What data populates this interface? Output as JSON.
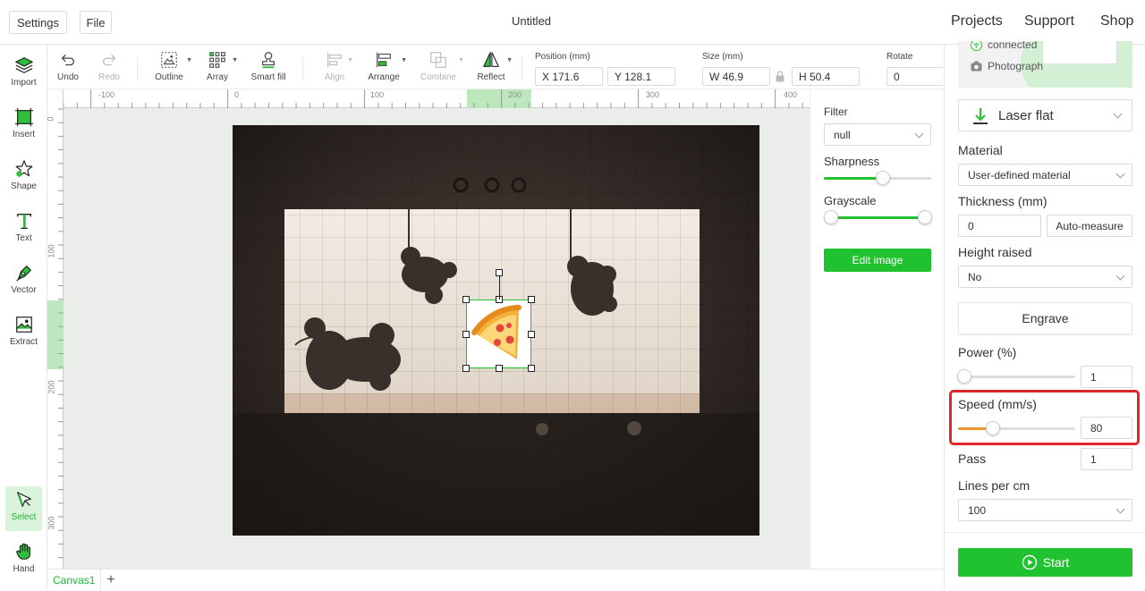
{
  "topbar": {
    "settings_label": "Settings",
    "file_label": "File",
    "title": "Untitled",
    "nav": [
      "Projects",
      "Support",
      "Shop"
    ]
  },
  "left_tools": [
    {
      "name": "import",
      "label": "Import"
    },
    {
      "name": "insert",
      "label": "Insert"
    },
    {
      "name": "shape",
      "label": "Shape"
    },
    {
      "name": "text",
      "label": "Text"
    },
    {
      "name": "vector",
      "label": "Vector"
    },
    {
      "name": "extract",
      "label": "Extract"
    },
    {
      "name": "select",
      "label": "Select"
    },
    {
      "name": "hand",
      "label": "Hand"
    }
  ],
  "edit_tools": {
    "undo": "Undo",
    "redo": "Redo",
    "outline": "Outline",
    "array": "Array",
    "smart_fill": "Smart fill",
    "align": "Align",
    "arrange": "Arrange",
    "combine": "Combine",
    "reflect": "Reflect"
  },
  "position": {
    "label": "Position (mm)",
    "x": "X 171.6",
    "y": "Y 128.1"
  },
  "size": {
    "label": "Size (mm)",
    "w": "W 46.9",
    "h": "H 50.4"
  },
  "rotate": {
    "label": "Rotate",
    "value": "0"
  },
  "ruler": {
    "h_ticks": [
      "-100",
      "0",
      "100",
      "200",
      "300",
      "400"
    ],
    "v_ticks": [
      "0",
      "100",
      "200",
      "300"
    ]
  },
  "tabs": {
    "canvas": "Canvas1",
    "add": "+"
  },
  "image_panel": {
    "filter_label": "Filter",
    "filter_value": "null",
    "sharpness_label": "Sharpness",
    "sharpness_level": 0.55,
    "grayscale_label": "Grayscale",
    "grayscale_level": 1.0,
    "edit_button": "Edit image"
  },
  "right_panel": {
    "status_connected": "connected",
    "photograph": "Photograph",
    "process_mode": "Laser flat",
    "material_label": "Material",
    "material_value": "User-defined material",
    "thickness_label": "Thickness (mm)",
    "thickness_value": "0",
    "auto_measure": "Auto-measure",
    "height_label": "Height raised",
    "height_value": "No",
    "engrave_button": "Engrave",
    "power_label": "Power (%)",
    "power_value": "1",
    "power_level": 0.0,
    "speed_label": "Speed (mm/s)",
    "speed_value": "80",
    "speed_level": 0.3,
    "pass_label": "Pass",
    "pass_value": "1",
    "lines_label": "Lines per cm",
    "lines_value": "100",
    "start_button": "Start"
  },
  "colors": {
    "accent_green": "#21c230",
    "highlight_red": "#e0262b",
    "speed_orange": "#f0932b"
  }
}
